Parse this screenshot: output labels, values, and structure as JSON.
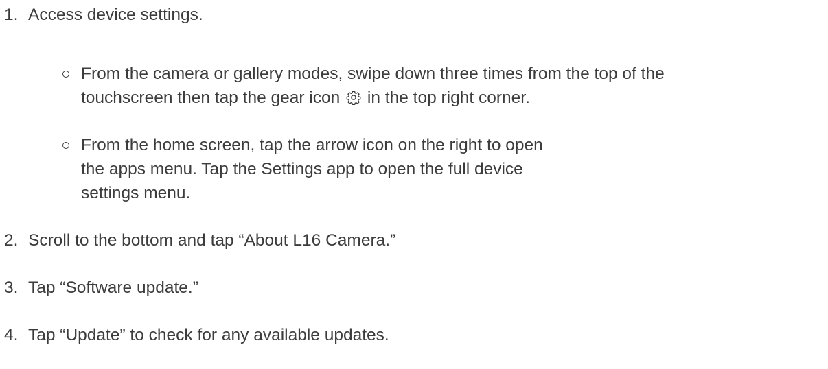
{
  "steps": [
    {
      "number": "1.",
      "text": "Access device settings.",
      "substeps": [
        {
          "lines": [
            "From the camera or gallery modes, swipe down three times from the top of the",
            "touchscreen then tap the gear icon",
            "in the top right corner."
          ],
          "icon": "gear-icon"
        },
        {
          "lines": [
            "From the home screen, tap the arrow icon on the right to open",
            "the apps menu. Tap the Settings app to open the full device",
            "settings menu."
          ]
        }
      ]
    },
    {
      "number": "2.",
      "text": "Scroll to the bottom and tap “About L16 Camera.”"
    },
    {
      "number": "3.",
      "text": "Tap “Software update.”"
    },
    {
      "number": "4.",
      "text": "Tap “Update” to check for any available updates."
    }
  ]
}
